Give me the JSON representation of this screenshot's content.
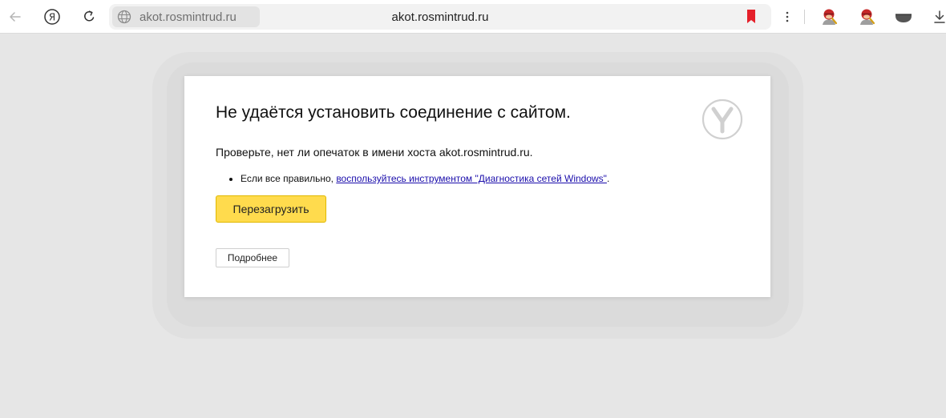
{
  "toolbar": {
    "address_chip_domain": "akot.rosmintrud.ru",
    "page_title": "akot.rosmintrud.ru",
    "icons": {
      "back": "arrow-left-icon",
      "yandex": "yandex-circle-icon",
      "reload": "reload-icon",
      "site_info": "globe-icon",
      "bookmark": "bookmark-icon",
      "menu": "dots-vertical-icon",
      "extensions": [
        "extension-avatar-icon",
        "extension-avatar-icon",
        "extension-dark-icon"
      ],
      "download": "download-icon"
    },
    "colors": {
      "bookmark": "#e5202a"
    }
  },
  "error_page": {
    "title": "Не удаётся установить соединение с сайтом.",
    "description": "Проверьте, нет ли опечаток в имени хоста akot.rosmintrud.ru.",
    "suggestion_prefix": "Если все правильно, ",
    "suggestion_link": "воспользуйтесь инструментом \"Диагностика сетей Windows\"",
    "suggestion_suffix": ".",
    "reload_button": "Перезагрузить",
    "details_button": "Подробнее",
    "logo_icon": "yandex-browser-logo-icon",
    "colors": {
      "reload_button": "#ffdb4d",
      "link": "#1a0dab"
    }
  }
}
